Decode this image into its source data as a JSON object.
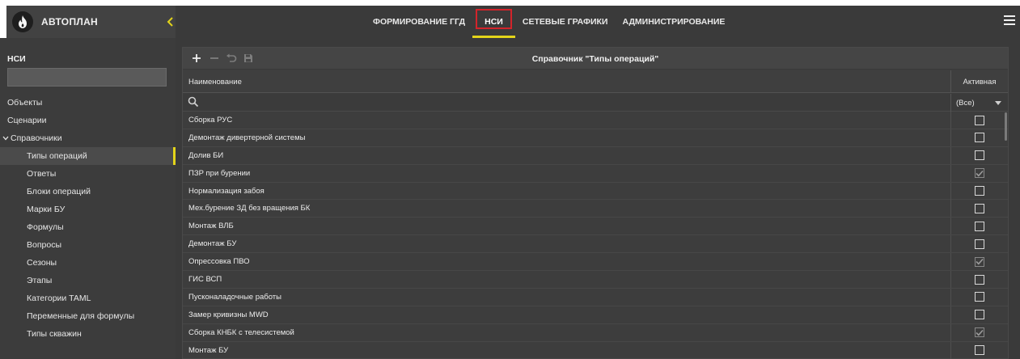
{
  "app": {
    "title": "АВТОПЛАН"
  },
  "nav": {
    "tabs": [
      {
        "label": "ФОРМИРОВАНИЕ ГГД"
      },
      {
        "label": "НСИ"
      },
      {
        "label": "СЕТЕВЫЕ ГРАФИКИ"
      },
      {
        "label": "АДМИНИСТРИРОВАНИЕ"
      }
    ],
    "active": "НСИ"
  },
  "sidebar": {
    "title": "НСИ",
    "search_value": "",
    "items": [
      {
        "label": "Объекты"
      },
      {
        "label": "Сценарии"
      },
      {
        "label": "Справочники"
      },
      {
        "label": "Типы операций"
      },
      {
        "label": "Ответы"
      },
      {
        "label": "Блоки операций"
      },
      {
        "label": "Марки БУ"
      },
      {
        "label": "Формулы"
      },
      {
        "label": "Вопросы"
      },
      {
        "label": "Сезоны"
      },
      {
        "label": "Этапы"
      },
      {
        "label": "Категории TAML"
      },
      {
        "label": "Переменные для формулы"
      },
      {
        "label": "Типы скважин"
      }
    ],
    "selected": "Типы операций"
  },
  "grid": {
    "title": "Справочник \"Типы операций\"",
    "columns": {
      "name": "Наименование",
      "active": "Активная"
    },
    "filter": {
      "name_value": "",
      "active_value": "(Все)"
    },
    "rows": [
      {
        "name": "Сборка РУС",
        "active": false
      },
      {
        "name": "Демонтаж дивертерной системы",
        "active": false
      },
      {
        "name": "Долив БИ",
        "active": false
      },
      {
        "name": "ПЗР при бурении",
        "active": true
      },
      {
        "name": "Нормализация забоя",
        "active": false
      },
      {
        "name": "Мех.бурение ЗД без вращения БК",
        "active": false
      },
      {
        "name": "Монтаж ВЛБ",
        "active": false
      },
      {
        "name": "Демонтаж БУ",
        "active": false
      },
      {
        "name": "Опрессовка ПВО",
        "active": true
      },
      {
        "name": "ГИС ВСП",
        "active": false
      },
      {
        "name": "Пусконаладочные работы",
        "active": false
      },
      {
        "name": "Замер кривизны MWD",
        "active": false
      },
      {
        "name": "Сборка КНБК с телесистемой",
        "active": true
      },
      {
        "name": "Монтаж БУ",
        "active": false
      }
    ]
  },
  "icons": {
    "logo": "flame-icon",
    "collapse": "chevron-left-icon",
    "menu": "hamburger-icon",
    "add": "plus-icon",
    "remove": "minus-icon",
    "undo": "undo-icon",
    "save": "save-icon",
    "search": "search-icon",
    "dropdown": "caret-down-icon"
  },
  "colors": {
    "accent": "#e3d41a",
    "highlight_box": "#d3242b",
    "background": "#3a3a3a"
  }
}
